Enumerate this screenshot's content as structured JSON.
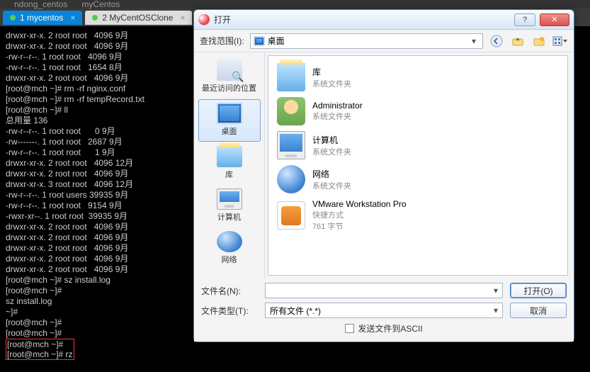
{
  "top_strip": {
    "a": "ndong_centos",
    "b": "myCentos"
  },
  "tabs": [
    {
      "label": "1 mycentos",
      "active": true
    },
    {
      "label": "2 MyCentOSClone",
      "active": false
    }
  ],
  "terminal": "drwxr-xr-x. 2 root root   4096 9月\ndrwxr-xr-x. 2 root root   4096 9月\n-rw-r--r--. 1 root root   4096 9月\n-rw-r--r--. 1 root root   1654 8月\ndrwxr-xr-x. 2 root root   4096 9月\n[root@mch ~]# rm -rf nginx.conf\n[root@mch ~]# rm -rf tempRecord.txt\n[root@mch ~]# ll\n总用量 136\n-rw-r--r--. 1 root root      0 9月\n-rw-------. 1 root root   2687 9月\n-rw-r--r--. 1 root root      1 9月\ndrwxr-xr-x. 2 root root   4096 12月\ndrwxr-xr-x. 2 root root   4096 9月\ndrwxr-xr-x. 3 root root   4096 12月\n-rw-r--r--. 1 root users 39935 9月\n-rw-r--r--. 1 root root   9154 9月\n-rwxr-xr--. 1 root root  39935 9月\ndrwxr-xr-x. 2 root root   4096 9月\ndrwxr-xr-x. 2 root root   4096 9月\ndrwxr-xr-x. 2 root root   4096 9月\ndrwxr-xr-x. 2 root root   4096 9月\ndrwxr-xr-x. 2 root root   4096 9月\n[root@mch ~]# sz install.log\n[root@mch ~]#\nsz install.log\n~]#\n[root@mch ~]#\n[root@mch ~]#",
  "terminal_boxed": "[root@mch ~]#\n[root@mch ~]# rz",
  "dialog": {
    "title": "打开",
    "lookin_label": "查找范围(I):",
    "path_value": "桌面",
    "places": [
      {
        "label": "最近访问的位置"
      },
      {
        "label": "桌面"
      },
      {
        "label": "库"
      },
      {
        "label": "计算机"
      },
      {
        "label": "网络"
      }
    ],
    "files": [
      {
        "name": "库",
        "sub": "系统文件夹"
      },
      {
        "name": "Administrator",
        "sub": "系统文件夹"
      },
      {
        "name": "计算机",
        "sub": "系统文件夹"
      },
      {
        "name": "网络",
        "sub": "系统文件夹"
      },
      {
        "name": "VMware Workstation Pro",
        "sub1": "快捷方式",
        "sub2": "761 字节"
      }
    ],
    "filename_label": "文件名(N):",
    "filename_value": "",
    "filetype_label": "文件类型(T):",
    "filetype_value": "所有文件 (*.*)",
    "open_btn": "打开(O)",
    "cancel_btn": "取消",
    "ascii_label": "发送文件到ASCII"
  }
}
